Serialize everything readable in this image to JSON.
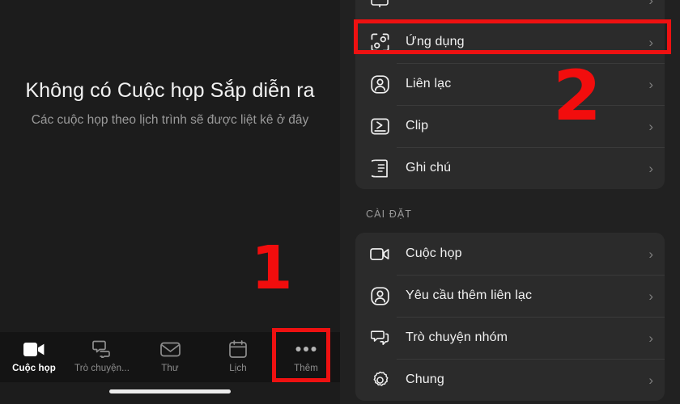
{
  "left": {
    "empty_state": {
      "title": "Không có Cuộc họp Sắp diễn ra",
      "subtitle": "Các cuộc họp theo lịch trình sẽ được liệt kê ở đây"
    },
    "annotation": "1",
    "tabs": [
      {
        "label": "Cuộc họp",
        "icon": "video-camera-icon",
        "active": true
      },
      {
        "label": "Trò chuyện...",
        "icon": "chat-bubbles-icon",
        "active": false
      },
      {
        "label": "Thư",
        "icon": "envelope-icon",
        "active": false
      },
      {
        "label": "Lịch",
        "icon": "calendar-icon",
        "active": false
      },
      {
        "label": "Thêm",
        "icon": "ellipsis-icon",
        "active": false
      }
    ]
  },
  "right": {
    "annotation": "2",
    "apps_group": [
      {
        "label": "Ứng dụng",
        "icon": "apps-frame-icon",
        "chevron": "›",
        "highlighted": true
      },
      {
        "label": "Liên lạc",
        "icon": "contact-person-icon",
        "chevron": "›",
        "highlighted": false
      },
      {
        "label": "Clip",
        "icon": "clip-play-icon",
        "chevron": "›",
        "highlighted": false
      },
      {
        "label": "Ghi chú",
        "icon": "notes-icon",
        "chevron": "›",
        "highlighted": false
      }
    ],
    "settings_header": "CÀI ĐẶT",
    "settings_group": [
      {
        "label": "Cuộc họp",
        "icon": "video-camera-icon",
        "chevron": "›"
      },
      {
        "label": "Yêu cầu thêm liên lạc",
        "icon": "contact-person-icon",
        "chevron": "›"
      },
      {
        "label": "Trò chuyện nhóm",
        "icon": "group-chat-icon",
        "chevron": "›"
      },
      {
        "label": "Chung",
        "icon": "gear-icon",
        "chevron": "›"
      }
    ]
  },
  "colors": {
    "annotation_red": "#ee1111",
    "left_bg": "#1c1c1c",
    "right_bg": "#212121",
    "card_bg": "#2b2b2b",
    "tabbar_bg": "#141414"
  }
}
